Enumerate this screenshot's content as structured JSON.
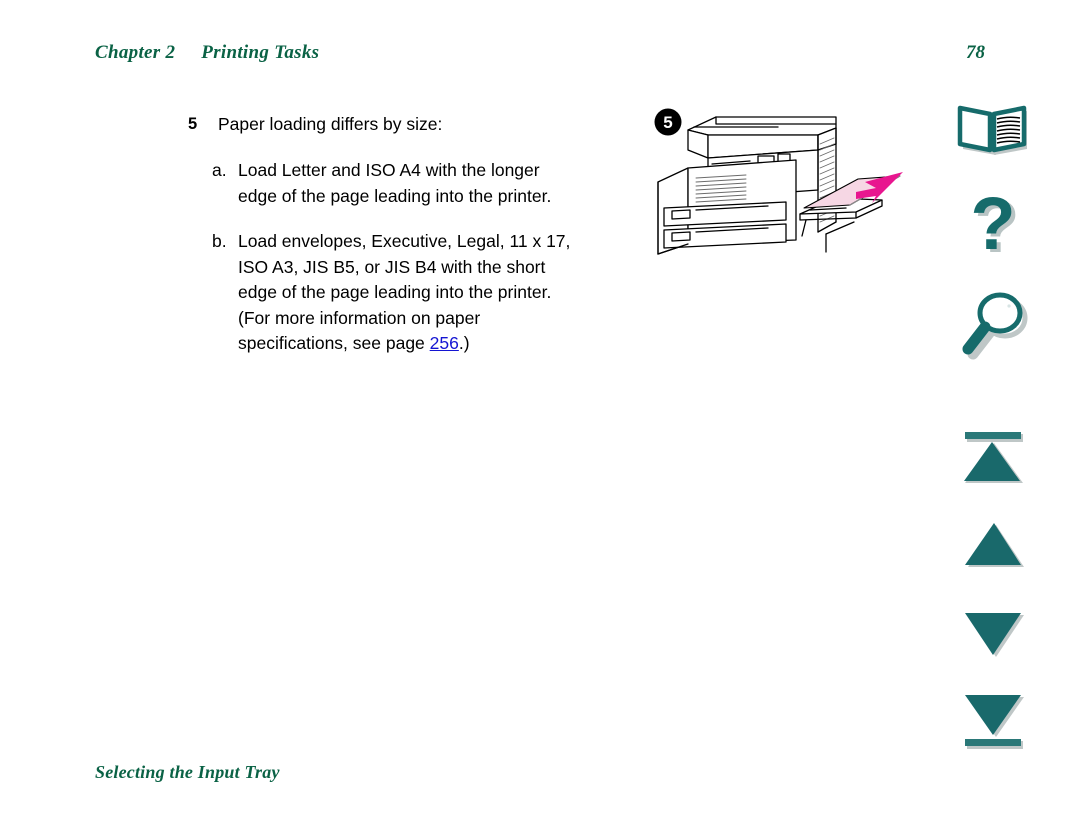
{
  "header": {
    "chapter": "Chapter 2",
    "title": "Printing Tasks",
    "page_number": "78"
  },
  "content": {
    "step": {
      "number": "5",
      "text": "Paper loading differs by size:"
    },
    "substeps": [
      {
        "marker": "a.",
        "lines": [
          "Load Letter and ISO A4 with the longer",
          "edge of the page leading into the printer."
        ]
      },
      {
        "marker": "b.",
        "lines": [
          "Load envelopes, Executive, Legal, 11 x 17,",
          "ISO A3, JIS B5, or JIS B4 with the short",
          "edge of the page leading into the printer.",
          "(For more information on paper"
        ],
        "last_line_prefix": "specifications, see page ",
        "link_text": "256",
        "last_line_suffix": ".)"
      }
    ]
  },
  "illustration": {
    "callout_number": "5",
    "alt": "Printer with paper being loaded into the side input tray",
    "paper_color": "#f6d7e4",
    "arrow_color": "#e8168f",
    "line_color": "#000000"
  },
  "sidebar": {
    "icons": [
      {
        "name": "book-icon",
        "label": "Contents"
      },
      {
        "name": "question-icon",
        "label": "Help"
      },
      {
        "name": "magnifier-icon",
        "label": "Search"
      },
      {
        "name": "first-page-icon",
        "label": "First page"
      },
      {
        "name": "previous-page-icon",
        "label": "Previous page"
      },
      {
        "name": "next-page-icon",
        "label": "Next page"
      },
      {
        "name": "last-page-icon",
        "label": "Last page"
      }
    ],
    "accent_color": "#166b6b"
  },
  "footer": {
    "section_title": "Selecting the Input Tray"
  }
}
